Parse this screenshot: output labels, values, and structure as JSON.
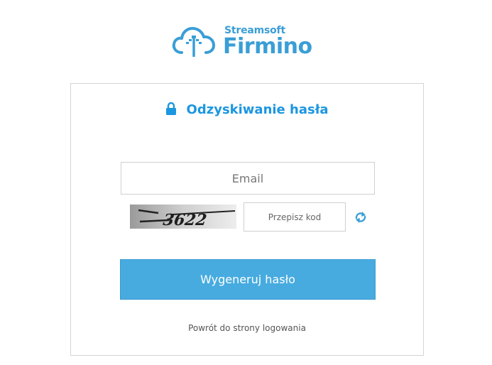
{
  "logo": {
    "brand": "Streamsoft",
    "product": "Firmino",
    "icon": "cloud-upload-icon",
    "color": "#3a9ed6"
  },
  "form": {
    "title": "Odzyskiwanie hasła",
    "title_icon": "lock-icon",
    "accent_color": "#1b96e0",
    "email": {
      "value": "",
      "placeholder": "Email"
    },
    "captcha": {
      "image_text": "3622",
      "input_value": "",
      "input_placeholder": "Przepisz kod",
      "refresh_icon": "refresh-icon"
    },
    "submit_label": "Wygeneruj hasło",
    "submit_color": "#47abe0",
    "back_link": "Powrót do strony logowania"
  }
}
